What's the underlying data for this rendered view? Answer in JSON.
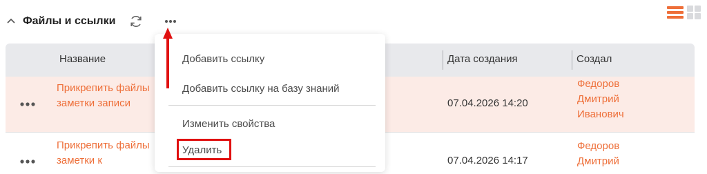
{
  "header": {
    "title": "Файлы и ссылки",
    "collapse_icon": "chevron-up-icon",
    "refresh_icon": "refresh-icon",
    "more_icon": "more-horizontal-icon"
  },
  "view_toggle": {
    "list_icon": "list-view-icon",
    "grid_icon": "grid-view-icon",
    "active": "list"
  },
  "table": {
    "columns": [
      "Название",
      "Дата создания",
      "Создал"
    ],
    "rows": [
      {
        "name_line1": "Прикрепить файлы",
        "name_line2": "заметки записи",
        "date": "07.04.2026 14:20",
        "author_line1": "Федоров",
        "author_line2": "Дмитрий",
        "author_line3": "Иванович",
        "highlighted": true
      },
      {
        "name_line1": "Прикрепить файлы",
        "name_line2": "заметки к",
        "date": "07.04.2026 14:17",
        "author_line1": "Федоров",
        "author_line2": "Дмитрий",
        "highlighted": false
      }
    ]
  },
  "menu": {
    "items": [
      "Добавить ссылку",
      "Добавить ссылку на базу знаний",
      "Изменить свойства",
      "Удалить"
    ],
    "highlighted_item": "Удалить"
  },
  "colors": {
    "accent": "#ee6f39",
    "row_highlight": "#fcebe6",
    "header_bg": "#e8e9ec",
    "annotation_red": "#e01010"
  }
}
